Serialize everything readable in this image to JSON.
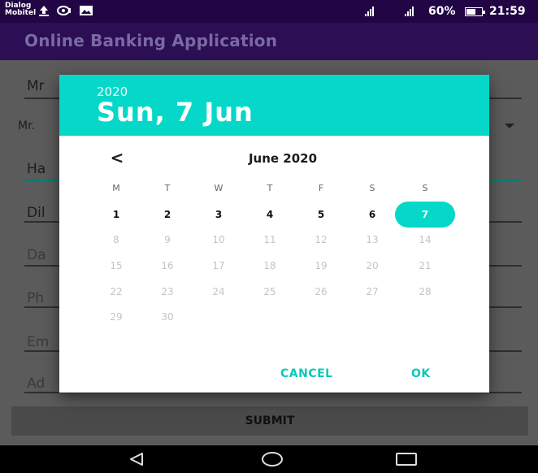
{
  "status_bar": {
    "carrier_line1": "Dialog",
    "carrier_line2": "Mobitel",
    "battery_text": "60%",
    "battery_level": 0.6,
    "time": "21:59"
  },
  "app_bar": {
    "title": "Online Banking Application"
  },
  "form": {
    "field1_text": "Mr",
    "spinner_value": "Mr.",
    "field2_text": "Ha",
    "field3_text": "Dil",
    "field4_hint": "Da",
    "field5_hint": "Ph",
    "field6_hint": "Em",
    "field7_hint": "Ad",
    "submit_label": "SUBMIT"
  },
  "date_picker": {
    "year": "2020",
    "selected_date": "Sun, 7 Jun",
    "month_label": "June 2020",
    "prev_label": "<",
    "weekdays": [
      "M",
      "T",
      "W",
      "T",
      "F",
      "S",
      "S"
    ],
    "weeks": [
      [
        "1",
        "2",
        "3",
        "4",
        "5",
        "6",
        "7"
      ],
      [
        "8",
        "9",
        "10",
        "11",
        "12",
        "13",
        "14"
      ],
      [
        "15",
        "16",
        "17",
        "18",
        "19",
        "20",
        "21"
      ],
      [
        "22",
        "23",
        "24",
        "25",
        "26",
        "27",
        "28"
      ],
      [
        "29",
        "30"
      ]
    ],
    "selected_day": "7",
    "max_enabled_day": 7,
    "cancel_label": "CANCEL",
    "ok_label": "OK",
    "accent_color": "#05d8c8"
  },
  "icons": {
    "status": [
      "upload-icon",
      "sync-icon",
      "image-icon",
      "signal-icon",
      "battery-icon"
    ],
    "nav": [
      "back-icon",
      "home-icon",
      "recents-icon"
    ]
  }
}
